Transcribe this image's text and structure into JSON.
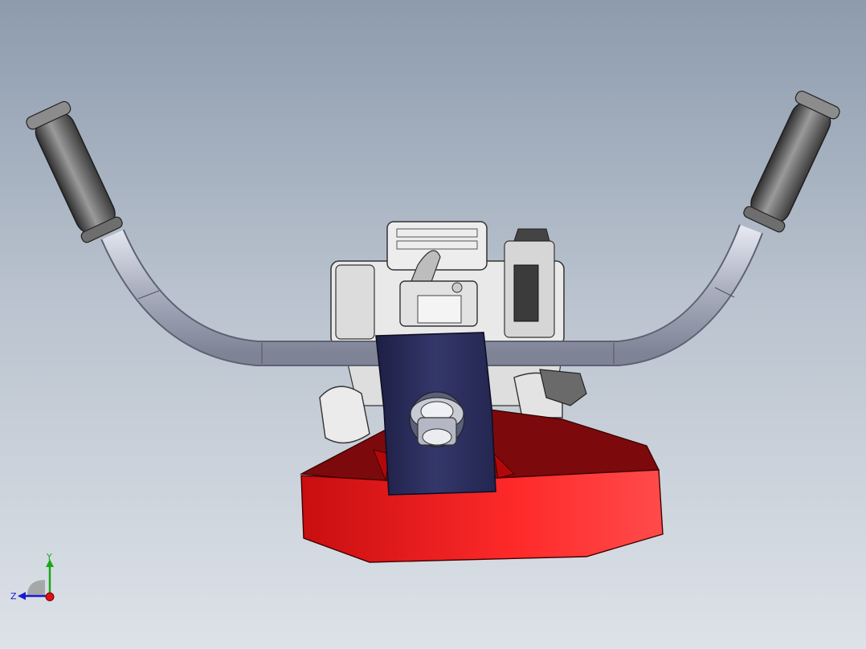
{
  "viewport": {
    "background_top": "#8d9bad",
    "background_bottom": "#dde2e8"
  },
  "model": {
    "parts": [
      {
        "name": "handlebar",
        "color": "#b8bccb"
      },
      {
        "name": "left-grip",
        "color": "#4a4a4a"
      },
      {
        "name": "right-grip",
        "color": "#4a4a4a"
      },
      {
        "name": "engine",
        "color": "#e6e6e6"
      },
      {
        "name": "mounting-plate",
        "color": "#2b2d59"
      },
      {
        "name": "tine-guard",
        "color": "#e8191b"
      }
    ]
  },
  "triad": {
    "y_label": "Y",
    "z_label": "Z",
    "y_color": "#1aa81a",
    "z_color": "#1a1ad0",
    "x_color": "#e01010"
  }
}
